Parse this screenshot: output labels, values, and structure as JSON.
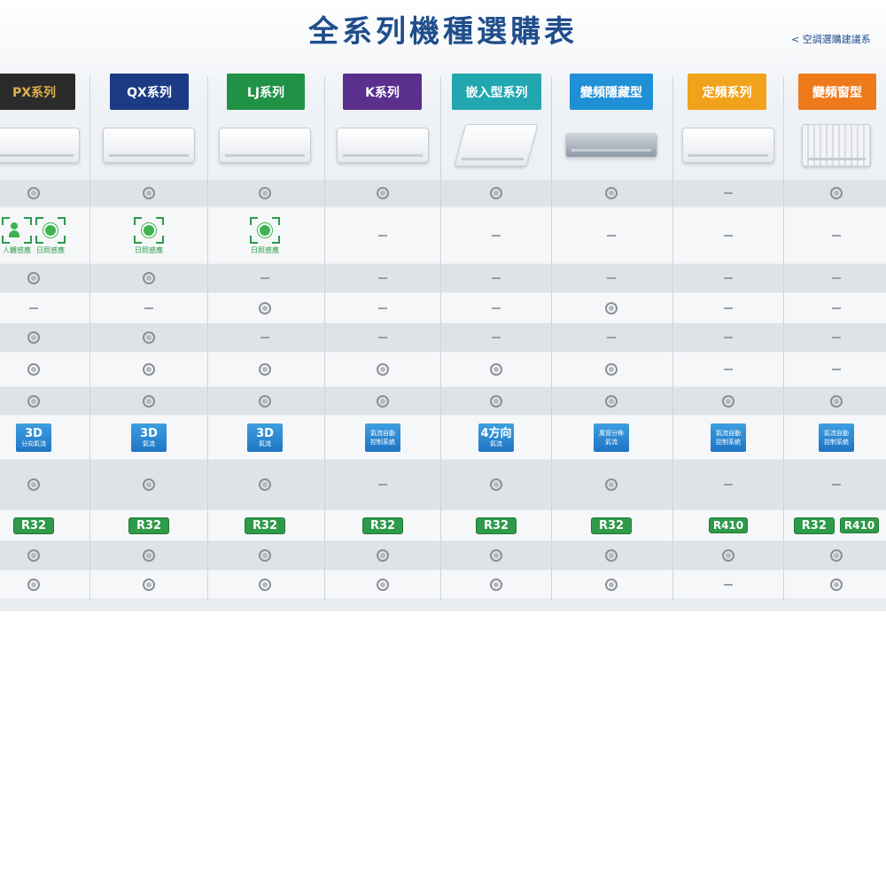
{
  "title": "全系列機種選購表",
  "sublink": "< 空調選購建議系",
  "columns": [
    {
      "name": "PX系列",
      "color": "#2b2b2b",
      "text_color": "#e0b04a"
    },
    {
      "name": "QX系列",
      "color": "#1c3b85",
      "text_color": "#ffffff"
    },
    {
      "name": "LJ系列",
      "color": "#1f9246",
      "text_color": "#ffffff"
    },
    {
      "name": "K系列",
      "color": "#5a2f8e",
      "text_color": "#ffffff"
    },
    {
      "name": "嵌入型系列",
      "color": "#22a6b0",
      "text_color": "#ffffff"
    },
    {
      "name": "變頻隱藏型",
      "color": "#1f8fd6",
      "text_color": "#ffffff"
    },
    {
      "name": "定頻系列",
      "color": "#f0a21a",
      "text_color": "#ffffff"
    },
    {
      "name": "變頻窗型",
      "color": "#ee7a1c",
      "text_color": "#ffffff"
    }
  ],
  "sensors": {
    "px": [
      "人體感應",
      "日照感應"
    ],
    "qx": [
      "日照感應"
    ],
    "lj": [
      "日照感應"
    ]
  },
  "airflow": {
    "px": {
      "big": "3D",
      "small": "分向氣流"
    },
    "qx": {
      "big": "3D",
      "small": "氣流"
    },
    "lj": {
      "big": "3D",
      "small": "氣流"
    },
    "k": {
      "big": "",
      "small": "氣流自動控制系統"
    },
    "emb": {
      "big": "4方向",
      "small": "氣流"
    },
    "duct": {
      "big": "",
      "small": "風管分佈氣流"
    },
    "fixed": {
      "big": "",
      "small": "氣流自動控制系統"
    },
    "window": {
      "big": "",
      "small": "氣流自動控制系統"
    }
  },
  "refrigerants": {
    "px": "R32",
    "qx": "R32",
    "lj": "R32",
    "k": "R32",
    "emb": "R32",
    "duct": "R32",
    "fixed": "R410",
    "window_a": "R32",
    "window_b": "R410"
  },
  "grid": [
    [
      "o",
      "o",
      "o",
      "o",
      "o",
      "o",
      "-",
      "o"
    ],
    [
      "sensor",
      "sensor",
      "sensor",
      "-",
      "-",
      "-",
      "-",
      "-"
    ],
    [
      "o",
      "o",
      "-",
      "-",
      "-",
      "-",
      "-",
      "-"
    ],
    [
      "-",
      "-",
      "o",
      "-",
      "-",
      "o",
      "-",
      "-"
    ],
    [
      "o",
      "o",
      "-",
      "-",
      "-",
      "-",
      "-",
      "-"
    ],
    [
      "o",
      "o",
      "o",
      "o",
      "o",
      "o",
      "-",
      "-"
    ],
    [
      "o",
      "o",
      "o",
      "o",
      "o",
      "o",
      "o",
      "o"
    ],
    [
      "air",
      "air",
      "air",
      "air",
      "air",
      "air",
      "air",
      "air"
    ],
    [
      "o",
      "o",
      "o",
      "-",
      "o",
      "o",
      "-",
      "-"
    ],
    [
      "ref",
      "ref",
      "ref",
      "ref",
      "ref",
      "ref",
      "ref",
      "ref"
    ],
    [
      "o",
      "o",
      "o",
      "o",
      "o",
      "o",
      "o",
      "o"
    ],
    [
      "o",
      "o",
      "o",
      "o",
      "o",
      "o",
      "-",
      "o"
    ]
  ]
}
